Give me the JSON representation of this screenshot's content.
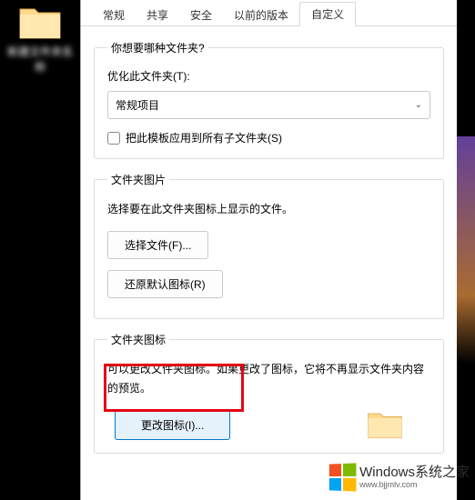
{
  "desktop": {
    "folder_label": "新建文件夹名称"
  },
  "tabs": {
    "general": "常规",
    "sharing": "共享",
    "security": "安全",
    "previous": "以前的版本",
    "customize": "自定义"
  },
  "section1": {
    "legend": "你想要哪种文件夹?",
    "optimize_label": "优化此文件夹(T):",
    "select_value": "常规项目",
    "apply_template_label": "把此模板应用到所有子文件夹(S)"
  },
  "section2": {
    "legend": "文件夹图片",
    "description": "选择要在此文件夹图标上显示的文件。",
    "choose_file_label": "选择文件(F)...",
    "restore_default_label": "还原默认图标(R)"
  },
  "section3": {
    "legend": "文件夹图标",
    "description": "可以更改文件夹图标。如果更改了图标，它将不再显示文件夹内容的预览。",
    "change_icon_label": "更改图标(I)..."
  },
  "watermark": {
    "main": "Windows系统之家",
    "sub": "www.bjjmlv.com"
  }
}
